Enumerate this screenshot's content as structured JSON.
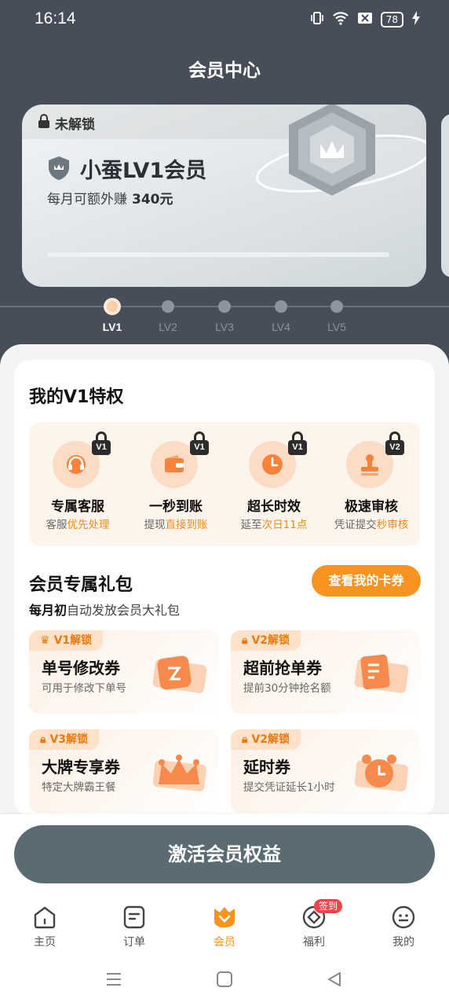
{
  "status_bar": {
    "time": "16:14",
    "battery": "78"
  },
  "header": {
    "title": "会员中心"
  },
  "level_card": {
    "lock_text": "未解锁",
    "name": "小蚕LV1会员",
    "subtitle": "每月可额外赚",
    "amount": "340元"
  },
  "levels": [
    {
      "label": "LV1",
      "active": true
    },
    {
      "label": "LV2",
      "active": false
    },
    {
      "label": "LV3",
      "active": false
    },
    {
      "label": "LV4",
      "active": false
    },
    {
      "label": "LV5",
      "active": false
    }
  ],
  "privileges": {
    "title": "我的V1特权",
    "items": [
      {
        "name": "专属客服",
        "desc_prefix": "客服",
        "desc_highlight": "优先处理",
        "desc_suffix": "",
        "lock": "V1",
        "icon": "headset-icon"
      },
      {
        "name": "一秒到账",
        "desc_prefix": "提现",
        "desc_highlight": "直接到账",
        "desc_suffix": "",
        "lock": "V1",
        "icon": "wallet-icon"
      },
      {
        "name": "超长时效",
        "desc_prefix": "延至",
        "desc_highlight": "次日11点",
        "desc_suffix": "",
        "lock": "V1",
        "icon": "clock-icon"
      },
      {
        "name": "极速审核",
        "desc_prefix": "凭证提交",
        "desc_highlight": "秒审核",
        "desc_suffix": "",
        "lock": "V2",
        "icon": "stamp-icon"
      }
    ]
  },
  "gift_pack": {
    "title": "会员专属礼包",
    "view_button": "查看我的卡券",
    "sub_bold": "每月初",
    "sub_rest": "自动发放会员大礼包",
    "coupons": [
      {
        "tag": "V1解锁",
        "tag_icon": "crown-icon",
        "title": "单号修改券",
        "desc": "可用于修改下单号",
        "art": "edit-ticket-icon"
      },
      {
        "tag": "V2解锁",
        "tag_icon": "lock-icon",
        "title": "超前抢单券",
        "desc": "提前30分钟抢名额",
        "art": "list-ticket-icon"
      },
      {
        "tag": "V3解锁",
        "tag_icon": "lock-icon",
        "title": "大牌专享券",
        "desc": "特定大牌霸王餐",
        "art": "crown-ticket-icon"
      },
      {
        "tag": "V2解锁",
        "tag_icon": "lock-icon",
        "title": "延时券",
        "desc": "提交凭证延长1小时",
        "art": "alarm-ticket-icon"
      }
    ]
  },
  "activate_button": "激活会员权益",
  "nav": {
    "items": [
      {
        "label": "主页",
        "icon": "home-icon",
        "active": false
      },
      {
        "label": "订单",
        "icon": "order-icon",
        "active": false
      },
      {
        "label": "会员",
        "icon": "vip-icon",
        "active": true
      },
      {
        "label": "福利",
        "icon": "welfare-icon",
        "active": false,
        "badge": "签到"
      },
      {
        "label": "我的",
        "icon": "profile-icon",
        "active": false
      }
    ]
  },
  "colors": {
    "accent": "#f7931e",
    "header_bg": "#474d59",
    "activate_btn": "#5b6b74",
    "badge_red": "#f2424b"
  }
}
